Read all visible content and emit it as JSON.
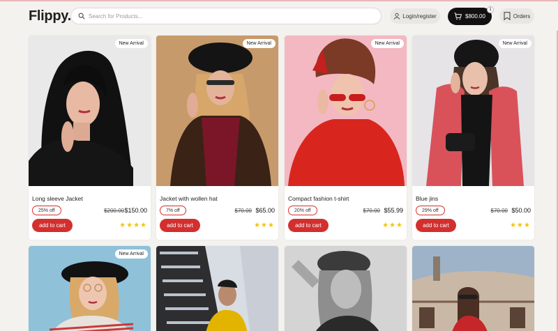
{
  "header": {
    "logo": "Flippy.",
    "search_placeholder": "Search for Products...",
    "login_label": "Login/register",
    "cart_amount": "$800.00",
    "cart_count": "1",
    "orders_label": "Orders"
  },
  "products": [
    {
      "badge": "New Arrival",
      "name": "Long sleeve Jacket",
      "discount": "25% off",
      "old_price": "$200.00",
      "price": "$150.00",
      "button": "add to cart",
      "stars": "★★★★"
    },
    {
      "badge": "New Arrival",
      "name": "Jacket with wollen hat",
      "discount": "7% off",
      "old_price": "$70.00",
      "price": "$65.00",
      "button": "add to cart",
      "stars": "★★★"
    },
    {
      "badge": "New Arrival",
      "name": "Compact fashion t-shirt",
      "discount": "20% off",
      "old_price": "$70.00",
      "price": "$55.99",
      "button": "add to cart",
      "stars": "★★★"
    },
    {
      "badge": "New Arrival",
      "name": "Blue jins",
      "discount": "29% off",
      "old_price": "$70.00",
      "price": "$50.00",
      "button": "add to cart",
      "stars": "★★★"
    }
  ],
  "second_row": [
    {
      "badge": "New Arrival"
    },
    {
      "badge": ""
    },
    {
      "badge": ""
    },
    {
      "badge": ""
    }
  ],
  "colors": {
    "accent": "#d32f2f",
    "star": "#f2c418",
    "dark": "#111111"
  }
}
